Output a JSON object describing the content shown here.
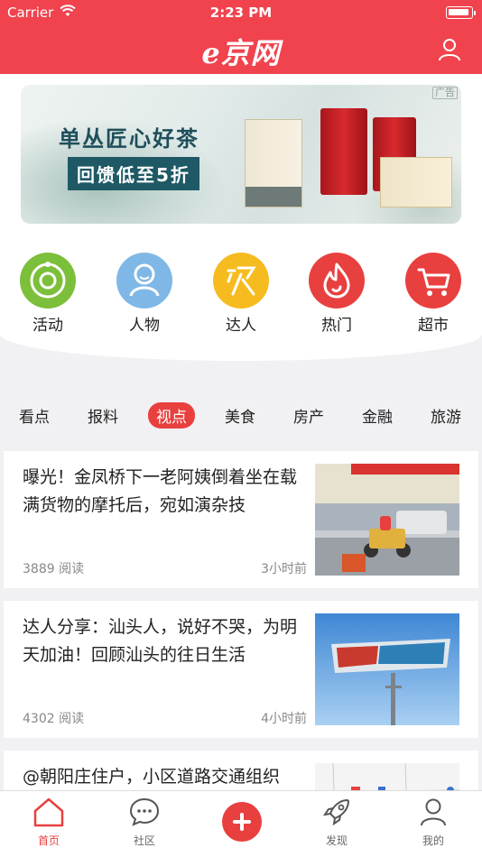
{
  "status_bar": {
    "carrier": "Carrier",
    "time": "2:23 PM"
  },
  "header": {
    "logo": "e京网",
    "icons": [
      "wifi-icon",
      "battery-icon",
      "user-icon"
    ]
  },
  "colors": {
    "brand": "#f0434e",
    "accent": "#e8403f"
  },
  "banner": {
    "headline": "单丛匠心好茶",
    "promo": "回馈低至5折",
    "ad_tag": "广告"
  },
  "quick_links": [
    {
      "label": "活动",
      "icon": "activity-icon",
      "color": "#7cbf3a"
    },
    {
      "label": "人物",
      "icon": "person-icon",
      "color": "#7fb8e6"
    },
    {
      "label": "达人",
      "icon": "expert-icon",
      "color": "#f6bb1f"
    },
    {
      "label": "热门",
      "icon": "fire-icon",
      "color": "#e8403f"
    },
    {
      "label": "超市",
      "icon": "cart-icon",
      "color": "#e8403f"
    }
  ],
  "category_tabs": [
    "看点",
    "报料",
    "视点",
    "美食",
    "房产",
    "金融",
    "旅游"
  ],
  "active_category": "视点",
  "articles": [
    {
      "title": "曝光！金凤桥下一老阿姨倒着坐在载满货物的摩托后，宛如演杂技",
      "reads": "3889 阅读",
      "time": "3小时前"
    },
    {
      "title": "达人分享：汕头人，说好不哭，为明天加油！回顾汕头的往日生活",
      "reads": "4302 阅读",
      "time": "4小时前"
    },
    {
      "title": "@朝阳庄住户，小区道路交通组织",
      "reads": "",
      "time": ""
    }
  ],
  "tab_bar": [
    {
      "label": "首页",
      "icon": "home-icon",
      "active": true
    },
    {
      "label": "社区",
      "icon": "chat-icon",
      "active": false
    },
    {
      "label": "",
      "icon": "plus-icon",
      "active": false
    },
    {
      "label": "发现",
      "icon": "rocket-icon",
      "active": false
    },
    {
      "label": "我的",
      "icon": "profile-icon",
      "active": false
    }
  ]
}
